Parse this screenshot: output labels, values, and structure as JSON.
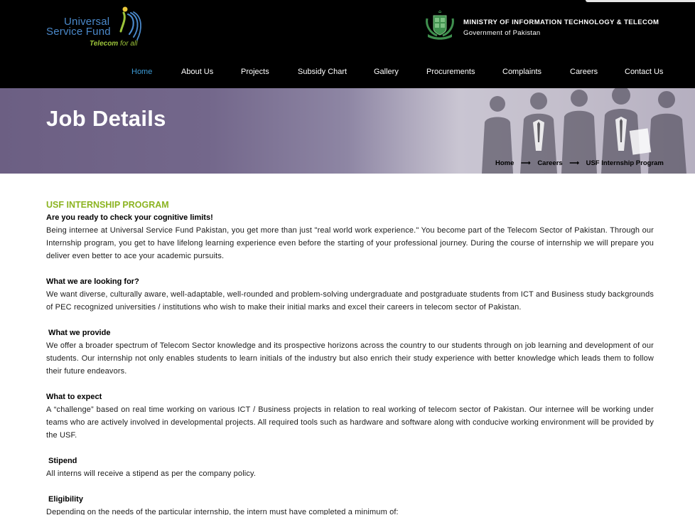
{
  "brand": {
    "line1": "Universal",
    "line2": "Service Fund",
    "tagline_bold": "Telecom",
    "tagline_rest": " for all",
    "ministry_name": "MINISTRY OF INFORMATION TECHNOLOGY & TELECOM",
    "ministry_sub": "Government of Pakistan"
  },
  "nav": {
    "items": [
      {
        "label": "Home"
      },
      {
        "label": "About Us"
      },
      {
        "label": "Projects"
      },
      {
        "label": "Subsidy Chart"
      },
      {
        "label": "Gallery"
      },
      {
        "label": "Procurements"
      },
      {
        "label": "Complaints"
      },
      {
        "label": "Careers"
      },
      {
        "label": "Contact Us"
      }
    ],
    "active_color": "#3d9bd6"
  },
  "banner": {
    "title": "Job Details",
    "breadcrumb": [
      "Home",
      "Careers",
      "USF Internship Program"
    ],
    "separator": "⟶"
  },
  "content": {
    "program_title": "USF INTERNSHIP PROGRAM",
    "intro_heading": "Are you ready to check your cognitive limits!",
    "intro_text": "Being internee at Universal Service Fund Pakistan, you get more than just \"real world work experience.\" You become part of the Telecom Sector of Pakistan. Through our Internship program, you get to have lifelong learning experience even before the starting of your professional journey. During the course of internship we will prepare you deliver even better to ace your academic pursuits.",
    "looking_heading": "What we are looking for?",
    "looking_text": "We want diverse, culturally aware, well-adaptable, well-rounded and problem-solving undergraduate and postgraduate students from ICT and Business study backgrounds of PEC recognized universities / institutions who wish to make their initial marks and excel their careers in telecom sector of Pakistan.",
    "provide_heading": " What we provide",
    "provide_text": "We offer a broader spectrum of Telecom Sector knowledge and its prospective horizons across the country to our students through on job learning and development of our students. Our internship not only enables students to learn initials of the industry but also enrich their study experience with better knowledge which leads them to follow their future endeavors.",
    "expect_heading": "What to expect",
    "expect_text": "A “challenge” based on real time working on various ICT / Business projects in relation to real working of telecom sector of Pakistan. Our internee will be working under teams who are actively involved in developmental projects. All required tools such as hardware and software along with conducive working environment will be provided by the USF.",
    "stipend_heading": " Stipend",
    "stipend_text": "All interns will receive a stipend as per the company policy.",
    "eligibility_heading": " Eligibility",
    "eligibility_text": "Depending on the needs of the particular internship, the intern must have completed a minimum of:"
  },
  "colors": {
    "header_bg": "#000000",
    "program_title": "#8cb421",
    "logo_blue": "#4a88c9",
    "logo_green": "#9cc43a"
  },
  "icons": [
    "usf-swoosh-icon",
    "pakistan-emblem-icon",
    "arrow-right-icon"
  ]
}
